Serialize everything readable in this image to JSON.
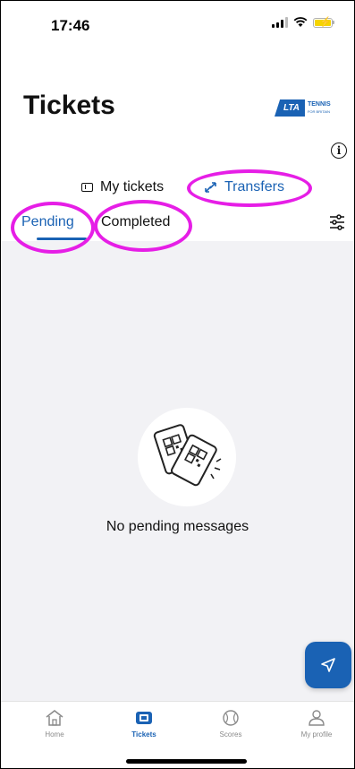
{
  "status_bar": {
    "time": "17:46"
  },
  "header": {
    "title": "Tickets",
    "logo_text": "LTA",
    "logo_sub": "TENNIS",
    "logo_sub2": "FOR BRITAIN"
  },
  "main_tabs": [
    {
      "label": "My tickets",
      "icon": "ticket-icon",
      "active": false
    },
    {
      "label": "Transfers",
      "icon": "transfer-arrows-icon",
      "active": true
    }
  ],
  "sub_tabs": [
    {
      "label": "Pending",
      "active": true
    },
    {
      "label": "Completed",
      "active": false
    }
  ],
  "empty_state": {
    "message": "No pending messages"
  },
  "bottom_nav": [
    {
      "label": "Home",
      "icon": "home-icon",
      "active": false
    },
    {
      "label": "Tickets",
      "icon": "tickets-icon",
      "active": true
    },
    {
      "label": "Scores",
      "icon": "tennis-ball-icon",
      "active": false
    },
    {
      "label": "My profile",
      "icon": "person-icon",
      "active": false
    }
  ],
  "colors": {
    "accent": "#1a62b4",
    "annotation": "#e61ee6",
    "content_bg": "#f2f2f5"
  }
}
